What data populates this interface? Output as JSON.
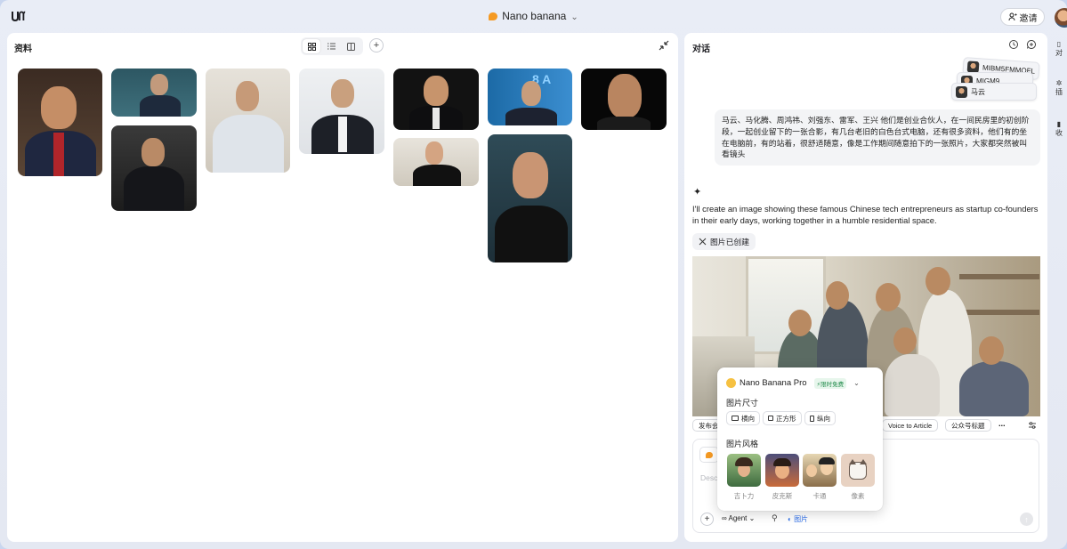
{
  "app": {
    "model_name": "Nano banana",
    "invite_label": "邀请"
  },
  "library": {
    "title": "资料",
    "view_modes": [
      "grid",
      "list",
      "split"
    ]
  },
  "chat": {
    "title": "对话",
    "ref_cards": [
      "MIBM5FMMQFL",
      "MIGM9...",
      "马云"
    ],
    "user_message": "马云、马化腾、周鸿祎、刘强东、雷军、王兴 他们是创业合伙人，在一间民房里的初创阶段，一起创业留下的一张合影，有几台老旧的白色台式电脑，还有很多资料，他们有的坐在电脑前，有的站着，很舒适随意，像是工作期间随意拍下的一张照片，大家都突然被叫看镜头",
    "ai_reply": "I'll create an image showing these famous Chinese tech entrepreneurs as startup co-founders in their early days, working together in a humble residential space.",
    "image_created_label": "图片已创建",
    "quick_actions": [
      "发布会",
      "Voice to Article",
      "公众号标题",
      "⋯"
    ],
    "composer": {
      "placeholder": "Desc",
      "agent_label": "Agent",
      "image_label": "图片"
    }
  },
  "popup": {
    "model": "Nano Banana Pro",
    "badge": "限时免费",
    "size_label": "图片尺寸",
    "sizes": [
      "横向",
      "正方形",
      "纵向"
    ],
    "style_label": "图片风格",
    "styles": [
      "吉卜力",
      "皮克斯",
      "卡通",
      "像素"
    ]
  },
  "side_strip": [
    "对",
    "插",
    "收"
  ]
}
